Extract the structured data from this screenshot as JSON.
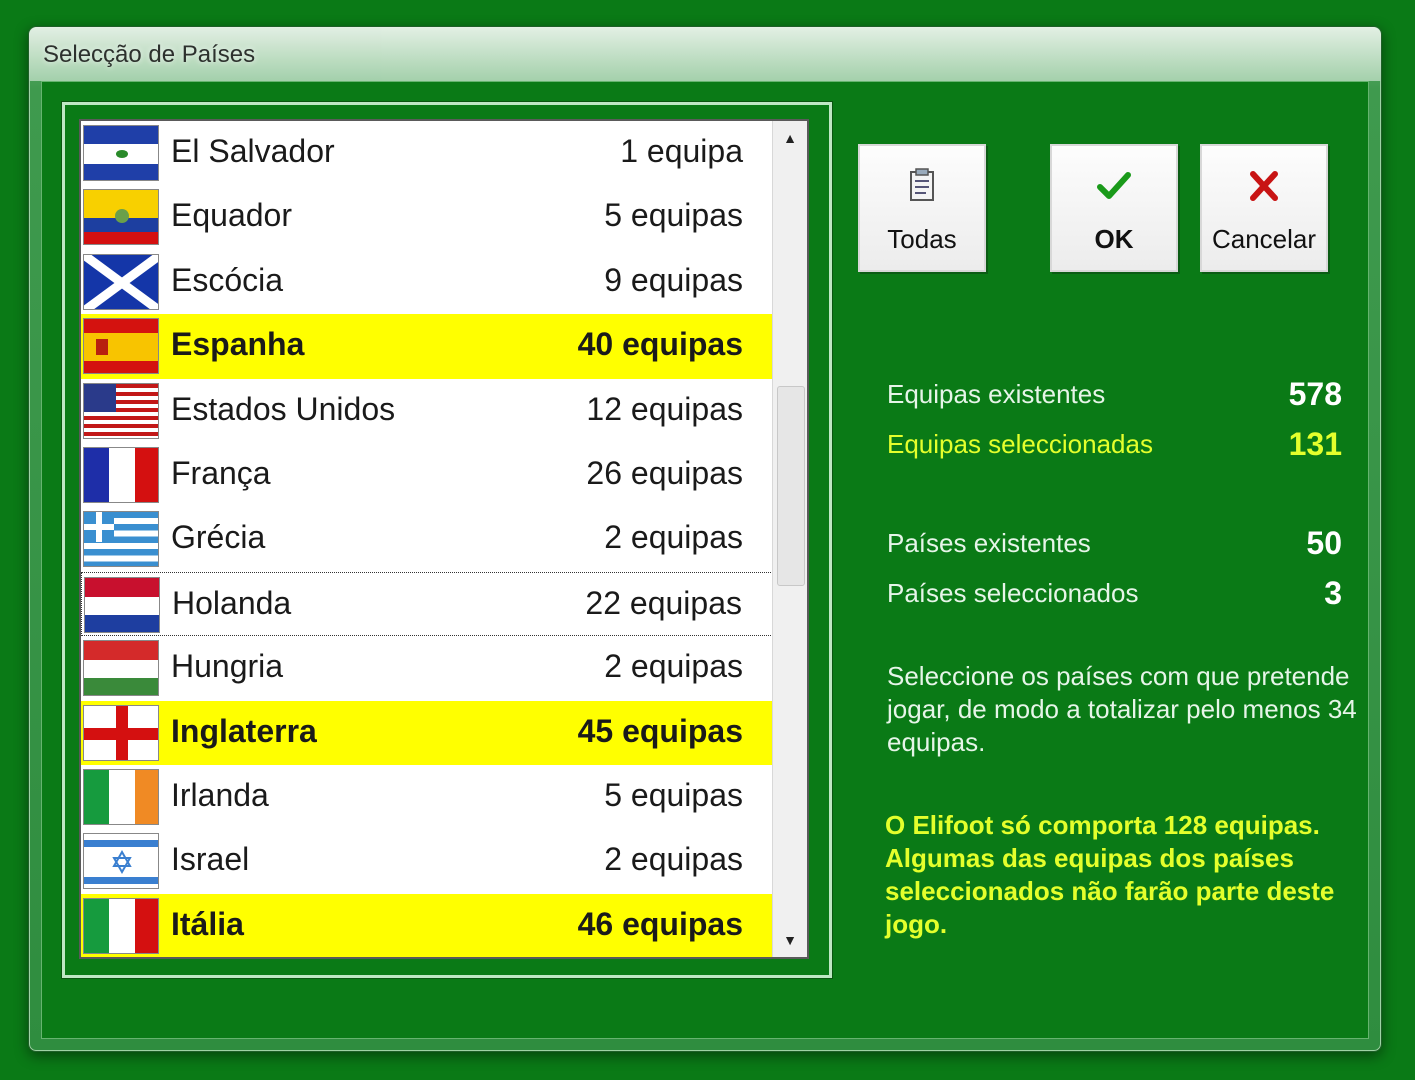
{
  "window": {
    "title": "Selecção de Países"
  },
  "countries": [
    {
      "name": "El Salvador",
      "count": "1 equipa",
      "selected": false,
      "flag": "el-salvador"
    },
    {
      "name": "Equador",
      "count": "5 equipas",
      "selected": false,
      "flag": "ecuador"
    },
    {
      "name": "Escócia",
      "count": "9 equipas",
      "selected": false,
      "flag": "scotland"
    },
    {
      "name": "Espanha",
      "count": "40 equipas",
      "selected": true,
      "flag": "spain"
    },
    {
      "name": "Estados Unidos",
      "count": "12 equipas",
      "selected": false,
      "flag": "usa"
    },
    {
      "name": "França",
      "count": "26 equipas",
      "selected": false,
      "flag": "france"
    },
    {
      "name": "Grécia",
      "count": "2 equipas",
      "selected": false,
      "flag": "greece"
    },
    {
      "name": "Holanda",
      "count": "22 equipas",
      "selected": false,
      "focused": true,
      "flag": "netherlands"
    },
    {
      "name": "Hungria",
      "count": "2 equipas",
      "selected": false,
      "flag": "hungary"
    },
    {
      "name": "Inglaterra",
      "count": "45 equipas",
      "selected": true,
      "flag": "england"
    },
    {
      "name": "Irlanda",
      "count": "5 equipas",
      "selected": false,
      "flag": "ireland"
    },
    {
      "name": "Israel",
      "count": "2 equipas",
      "selected": false,
      "flag": "israel"
    },
    {
      "name": "Itália",
      "count": "46 equipas",
      "selected": true,
      "flag": "italy"
    }
  ],
  "buttons": {
    "todas": {
      "label": "Todas",
      "icon": "clipboard-icon"
    },
    "ok": {
      "label": "OK",
      "icon": "checkmark-icon"
    },
    "cancelar": {
      "label": "Cancelar",
      "icon": "x-icon"
    }
  },
  "stats": {
    "equipas_existentes_label": "Equipas existentes",
    "equipas_existentes_value": "578",
    "equipas_seleccionadas_label": "Equipas seleccionadas",
    "equipas_seleccionadas_value": "131",
    "paises_existentes_label": "Países existentes",
    "paises_existentes_value": "50",
    "paises_seleccionados_label": "Países seleccionados",
    "paises_seleccionados_value": "3"
  },
  "info_text": "Seleccione os países com que pretende jogar, de modo a totalizar pelo menos 34 equipas.",
  "warning_text": "O Elifoot só comporta 128 equipas. Algumas das equipas dos países seleccionados não farão parte deste jogo.",
  "colors": {
    "background": "#0a7a16",
    "highlight": "#ffff00",
    "accent_text": "#e4ff2c"
  }
}
